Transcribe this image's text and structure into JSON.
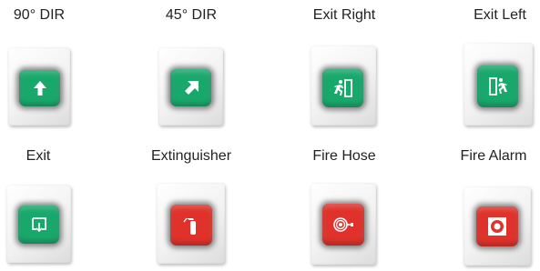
{
  "colors": {
    "green": "#19a86c",
    "red": "#e0322b",
    "icon": "#ffffff"
  },
  "signs": [
    {
      "label": "90° DIR",
      "color": "green",
      "icon": "arrow-up-icon"
    },
    {
      "label": "45° DIR",
      "color": "green",
      "icon": "arrow-up-right-icon"
    },
    {
      "label": "Exit Right",
      "color": "green",
      "icon": "exit-right-icon"
    },
    {
      "label": "Exit Left",
      "color": "green",
      "icon": "exit-left-icon"
    },
    {
      "label": "Exit",
      "color": "green",
      "icon": "exit-door-icon"
    },
    {
      "label": "Extinguisher",
      "color": "red",
      "icon": "fire-extinguisher-icon"
    },
    {
      "label": "Fire Hose",
      "color": "red",
      "icon": "fire-hose-icon"
    },
    {
      "label": "Fire Alarm",
      "color": "red",
      "icon": "fire-alarm-icon"
    }
  ]
}
